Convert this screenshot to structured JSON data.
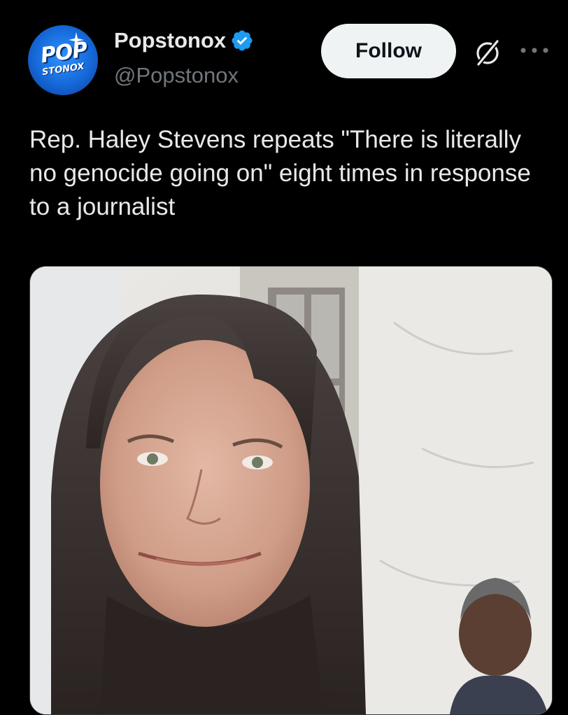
{
  "account": {
    "avatar_text_top": "POP",
    "avatar_text_bottom": "STONOX",
    "display_name": "Popstonox",
    "handle": "@Popstonox",
    "verified": true
  },
  "actions": {
    "follow_label": "Follow"
  },
  "tweet": {
    "text": "Rep. Haley Stevens repeats \"There is literally no genocide going on\" eight times in response to a journalist"
  },
  "colors": {
    "background": "#000000",
    "text_primary": "#e7e9ea",
    "text_secondary": "#71767b",
    "verified_blue": "#1d9bf0",
    "follow_bg": "#eff3f4"
  },
  "icons": {
    "verified": "verified-badge-icon",
    "grok": "grok-icon",
    "more": "more-options-icon"
  }
}
